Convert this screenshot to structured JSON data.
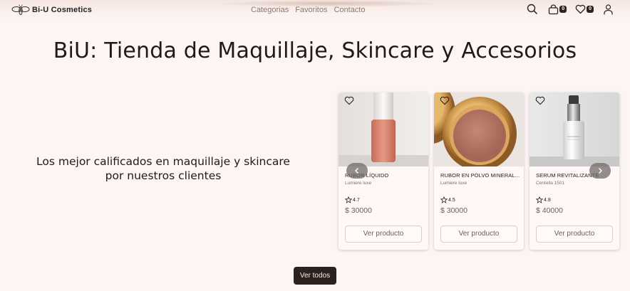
{
  "header": {
    "brand": "Bi-U Cosmetics",
    "nav": [
      "Categorias",
      "Favoritos",
      "Contacto"
    ],
    "cart_count": "0",
    "favorites_count": "0"
  },
  "hero": {
    "title": "BiU: Tienda de Maquillaje, Skincare y Accesorios",
    "subtitle_line1": "Los mejor calificados en maquillaje y skincare",
    "subtitle_line2": "por nuestros clientes"
  },
  "products": [
    {
      "name": "RUBOR LÍQUIDO",
      "brand": "Lumiere luxe",
      "rating": "4.7",
      "price": "$ 30000",
      "button": "Ver producto"
    },
    {
      "name": "RUBOR EN POLVO MINERAL...",
      "brand": "Lumiere luxe",
      "rating": "4.5",
      "price": "$ 30000",
      "button": "Ver producto"
    },
    {
      "name": "SERUM REVITALIZANTE",
      "brand": "Centella 1501",
      "rating": "4.8",
      "price": "$ 40000",
      "button": "Ver producto"
    }
  ],
  "footer_button": "Ver todos",
  "colors": {
    "background": "#fdf5f3",
    "dark_button": "#2c211d",
    "text_muted": "#8a7a74"
  },
  "icons": [
    "bee-logo-icon",
    "search-icon",
    "cart-icon",
    "heart-icon",
    "user-icon",
    "chevron-left-icon",
    "chevron-right-icon",
    "star-icon"
  ]
}
